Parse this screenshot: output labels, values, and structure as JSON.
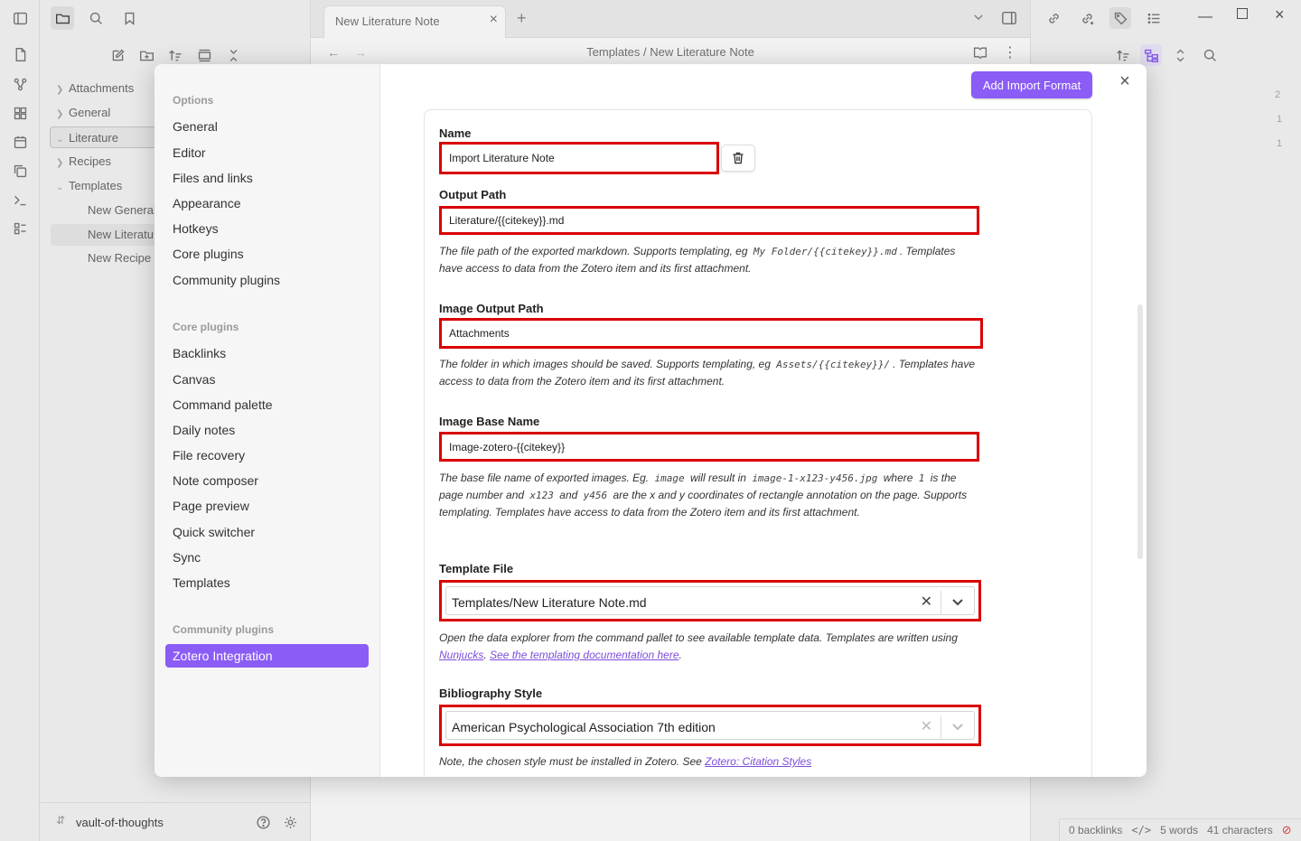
{
  "editor": {
    "tab_title": "New Literature Note",
    "breadcrumb": "Templates  /  New Literature Note"
  },
  "file_tree": {
    "items": [
      {
        "label": "Attachments"
      },
      {
        "label": "General"
      },
      {
        "label": "Literature"
      },
      {
        "label": "Recipes"
      },
      {
        "label": "Templates"
      },
      {
        "label": "New General"
      },
      {
        "label": "New Literatu"
      },
      {
        "label": "New Recipe I"
      }
    ]
  },
  "vault": {
    "name": "vault-of-thoughts"
  },
  "right_panel": {
    "counts": [
      "2",
      "1",
      "1"
    ]
  },
  "status_bar": {
    "backlinks": "0 backlinks",
    "words": "5 words",
    "characters": "41 characters"
  },
  "settings_nav": {
    "options_heading": "Options",
    "options": [
      "General",
      "Editor",
      "Files and links",
      "Appearance",
      "Hotkeys",
      "Core plugins",
      "Community plugins"
    ],
    "core_heading": "Core plugins",
    "core": [
      "Backlinks",
      "Canvas",
      "Command palette",
      "Daily notes",
      "File recovery",
      "Note composer",
      "Page preview",
      "Quick switcher",
      "Sync",
      "Templates"
    ],
    "community_heading": "Community plugins",
    "community": [
      "Zotero Integration"
    ]
  },
  "import_format": {
    "add_button": "Add Import Format",
    "name_label": "Name",
    "name_value": "Import Literature Note",
    "output_path_label": "Output Path",
    "output_path_value": "Literature/{{citekey}}.md",
    "output_path_desc_1": "The file path of the exported markdown. Supports templating, eg",
    "output_path_desc_code": "My Folder/{{citekey}}.md",
    "output_path_desc_2": ". Templates have access to data from the Zotero item and its first attachment.",
    "image_output_label": "Image Output Path",
    "image_output_value": "Attachments",
    "image_output_desc_1": "The folder in which images should be saved. Supports templating, eg",
    "image_output_desc_code": "Assets/{{citekey}}/",
    "image_output_desc_2": ". Templates have access to data from the Zotero item and its first attachment.",
    "image_base_label": "Image Base Name",
    "image_base_value": "Image-zotero-{{citekey}}",
    "image_base_desc_1": "The base file name of exported images. Eg.",
    "image_base_desc_code1": "image",
    "image_base_desc_2": "will result in",
    "image_base_desc_code2": "image-1-x123-y456.jpg",
    "image_base_desc_3": "where",
    "image_base_desc_code3": "1",
    "image_base_desc_4": "is the page number and",
    "image_base_desc_code4": "x123",
    "image_base_desc_5": "and",
    "image_base_desc_code5": "y456",
    "image_base_desc_6": "are the x and y coordinates of rectangle annotation on the page. Supports templating. Templates have access to data from the Zotero item and its first attachment.",
    "template_file_label": "Template File",
    "template_file_value": "Templates/New Literature Note.md",
    "template_desc_1": "Open the data explorer from the command pallet to see available template data. Templates are written using",
    "template_link_1": "Nunjucks",
    "template_link_2": "See the templating documentation here",
    "bib_style_label": "Bibliography Style",
    "bib_style_value": "American Psychological Association 7th edition",
    "bib_desc": "Note, the chosen style must be installed in Zotero. See",
    "bib_link": "Zotero: Citation Styles"
  }
}
